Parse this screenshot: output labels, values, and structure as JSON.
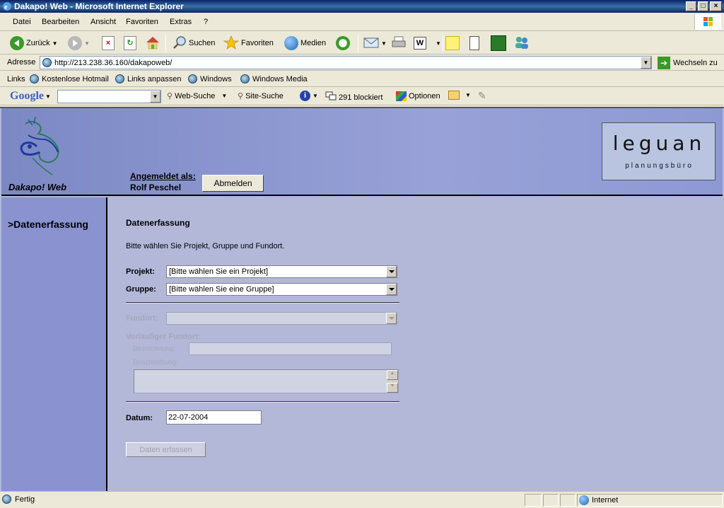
{
  "window": {
    "title": "Dakapo! Web - Microsoft Internet Explorer"
  },
  "menu": [
    "Datei",
    "Bearbeiten",
    "Ansicht",
    "Favoriten",
    "Extras",
    "?"
  ],
  "toolbar": {
    "back": "Zurück",
    "search": "Suchen",
    "favorites": "Favoriten",
    "media": "Medien"
  },
  "address": {
    "label": "Adresse",
    "url": "http://213.238.36.160/dakapoweb/",
    "go": "Wechseln zu"
  },
  "links": {
    "label": "Links",
    "items": [
      "Kostenlose Hotmail",
      "Links anpassen",
      "Windows",
      "Windows Media"
    ]
  },
  "google": {
    "logo": "Google",
    "web_search": "Web-Suche",
    "site_search": "Site-Suche",
    "blocked": "291 blockiert",
    "options": "Optionen"
  },
  "header": {
    "app_name": "Dakapo! Web",
    "logged_in_label": "Angemeldet als:",
    "user": "Rolf Peschel",
    "logout": "Abmelden",
    "logo_top": "leguan",
    "logo_bottom": "planungsbüro"
  },
  "sidebar": {
    "nav_item": ">Datenerfassung"
  },
  "form": {
    "title": "Datenerfassung",
    "intro": "Bitte wählen Sie Projekt, Gruppe und Fundort.",
    "projekt_label": "Projekt:",
    "projekt_value": "[Bitte wählen Sie ein Projekt]",
    "gruppe_label": "Gruppe:",
    "gruppe_value": "[Bitte wählen Sie eine Gruppe]",
    "fundort_label": "Fundort:",
    "vorlaeufig_label": "Vorläufiger Fundort:",
    "bezeichnung_label": "Bezeichnung:",
    "beschreibung_label": "Beschreibung:",
    "datum_label": "Datum:",
    "datum_value": "22-07-2004",
    "submit": "Daten erfassen"
  },
  "status": {
    "text": "Fertig",
    "zone": "Internet"
  },
  "colors": {
    "title_bar": "#0a246a",
    "header_bg": "#8e99d4",
    "main_bg": "#b3b8d9"
  }
}
